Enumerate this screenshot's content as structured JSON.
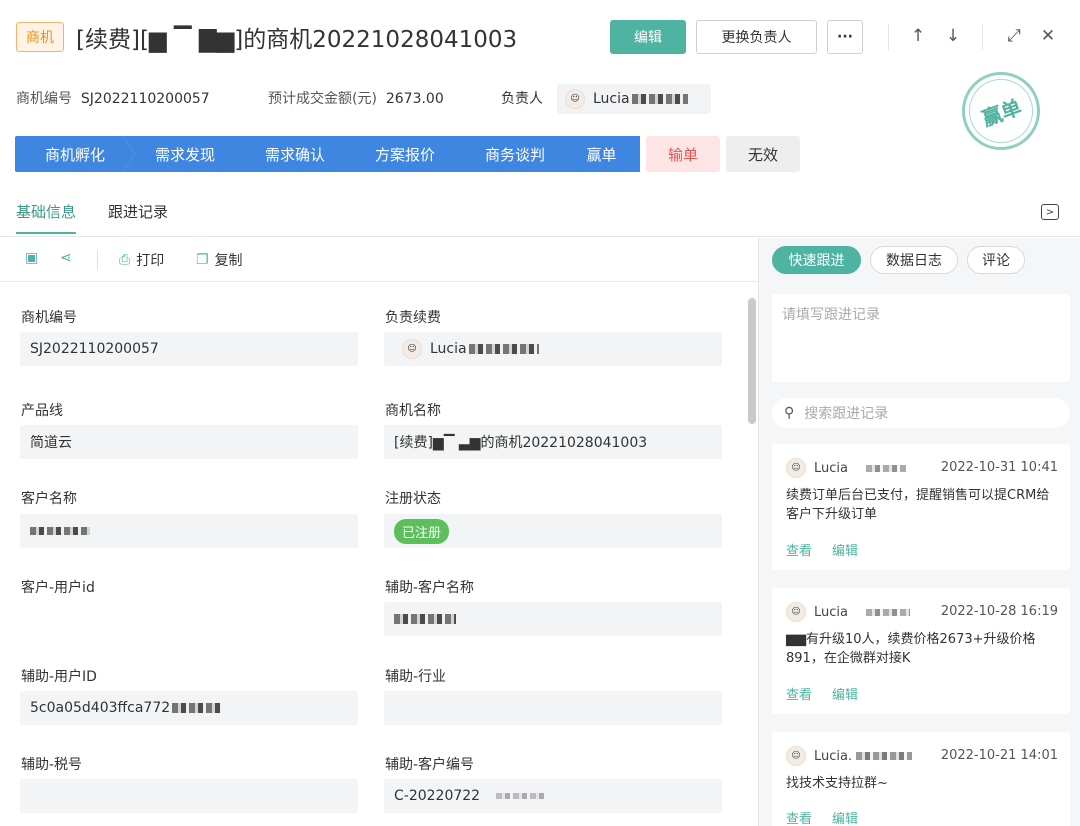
{
  "header": {
    "tag": "商机",
    "title": "[续费][▆ ▔ ▇▆]的商机20221028041003",
    "edit_label": "编辑",
    "change_owner_label": "更换负责人",
    "more_label": "···",
    "up_icon": "↑",
    "down_icon": "↓",
    "expand_icon": "⤢",
    "close_icon": "✕"
  },
  "meta": {
    "code_label": "商机编号",
    "code_value": "SJ2022110200057",
    "amount_label": "预计成交金额(元)",
    "amount_value": "2673.00",
    "owner_label": "负责人",
    "owner_name": "Lucia"
  },
  "stamp": "赢单",
  "stages": [
    "商机孵化",
    "需求发现",
    "需求确认",
    "方案报价",
    "商务谈判",
    "赢单"
  ],
  "lose_label": "输单",
  "void_label": "无效",
  "tabs": [
    "基础信息",
    "跟进记录"
  ],
  "toolbar": {
    "print_label": "打印",
    "copy_label": "复制"
  },
  "fields": {
    "code": {
      "label": "商机编号",
      "value": "SJ2022110200057"
    },
    "renewal_owner": {
      "label": "负责续费",
      "value": "Lucia"
    },
    "product_line": {
      "label": "产品线",
      "value": "简道云"
    },
    "opp_name": {
      "label": "商机名称",
      "value": "[续费]▆▔ ▃▆的商机20221028041003"
    },
    "customer_name": {
      "label": "客户名称",
      "value": ""
    },
    "reg_status": {
      "label": "注册状态",
      "value": "已注册"
    },
    "customer_user_id": {
      "label": "客户-用户id",
      "value": ""
    },
    "aux_customer_name": {
      "label": "辅助-客户名称",
      "value": ""
    },
    "aux_user_id": {
      "label": "辅助-用户ID",
      "value": "5c0a05d403ffca772"
    },
    "aux_industry": {
      "label": "辅助-行业",
      "value": ""
    },
    "aux_tax": {
      "label": "辅助-税号",
      "value": ""
    },
    "aux_customer_code": {
      "label": "辅助-客户编号",
      "value": "C-20220722"
    }
  },
  "right": {
    "tabs": [
      "快速跟进",
      "数据日志",
      "评论"
    ],
    "note_placeholder": "请填写跟进记录",
    "search_placeholder": "搜索跟进记录",
    "records": [
      {
        "user": "Lucia",
        "time": "2022-10-31 10:41",
        "text": "续费订单后台已支付，提醒销售可以提CRM给客户下升级订单",
        "view": "查看",
        "edit": "编辑"
      },
      {
        "user": "Lucia",
        "time": "2022-10-28 16:19",
        "text": "▆▆有升级10人，续费价格2673+升级价格891，在企微群对接K",
        "view": "查看",
        "edit": "编辑"
      },
      {
        "user": "Lucia.",
        "time": "2022-10-21 14:01",
        "text": "找技术支持拉群~",
        "view": "查看",
        "edit": "编辑"
      }
    ]
  },
  "colors": {
    "accent": "#4fb3a1",
    "stage_blue": "#3f86e0",
    "lose_red": "#e45656",
    "tag_orange": "#f08c1a"
  }
}
